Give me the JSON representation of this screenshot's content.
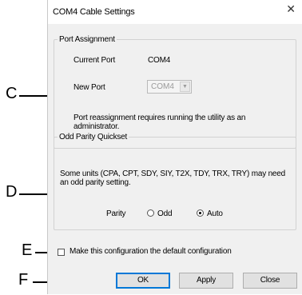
{
  "window": {
    "title": "COM4 Cable Settings",
    "close_glyph": "✕"
  },
  "port_assignment": {
    "legend": "Port Assignment",
    "current_port_label": "Current Port",
    "current_port_value": "COM4",
    "new_port_label": "New Port",
    "new_port_selected": "COM4",
    "note": "Port reassignment requires running the utility as an administrator."
  },
  "odd_parity": {
    "legend": "Odd Parity Quickset",
    "note": "Some units (CPA, CPT, SDY, SIY, T2X, TDY, TRX, TRY) may need an odd parity setting.",
    "parity_label": "Parity",
    "options": [
      "Odd",
      "Auto"
    ],
    "selected": "Auto"
  },
  "default_checkbox": {
    "label": "Make this configuration the default configuration",
    "checked": false
  },
  "buttons": {
    "ok": "OK",
    "apply": "Apply",
    "close": "Close"
  },
  "callouts": {
    "c": "C",
    "d": "D",
    "e": "E",
    "f": "F"
  },
  "icons": {
    "dropdown": "chevron-down-icon",
    "close": "close-icon"
  },
  "colors": {
    "dialog_bg": "#f0f0f0",
    "default_button_border": "#0078d7"
  }
}
